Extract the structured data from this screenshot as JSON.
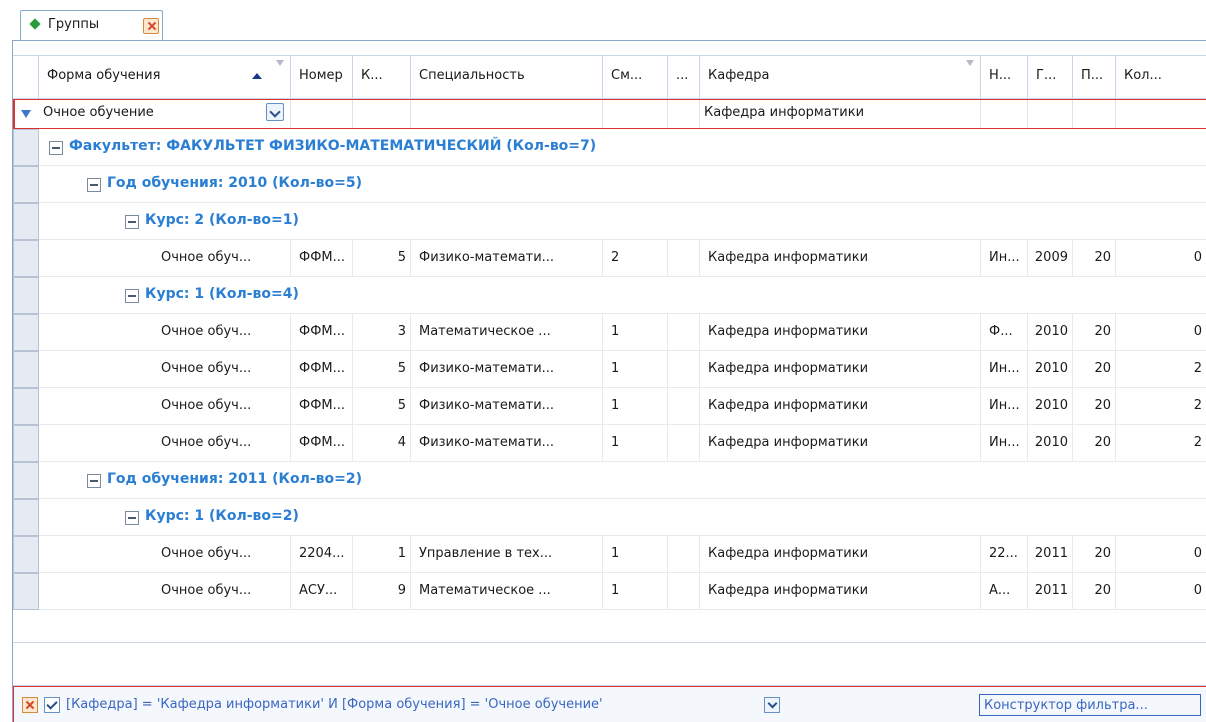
{
  "tab": {
    "title": "Группы"
  },
  "columns": [
    "Форма обучения",
    "Номер",
    "К...",
    "Специальность",
    "См...",
    "...",
    "Кафедра",
    "Н...",
    "Г...",
    "П...",
    "Кол..."
  ],
  "filter_row": {
    "form": "Очное обучение",
    "department": "Кафедра информатики"
  },
  "rows": [
    {
      "kind": "group",
      "level": 0,
      "label": "Факультет: ФАКУЛЬТЕТ ФИЗИКО-МАТЕМАТИЧЕСКИЙ (Кол-во=7)"
    },
    {
      "kind": "group",
      "level": 1,
      "label": "Год обучения: 2010 (Кол-во=5)"
    },
    {
      "kind": "group",
      "level": 2,
      "label": "Курс: 2 (Кол-во=1)"
    },
    {
      "kind": "data",
      "cells": [
        "Очное обуч...",
        "ФФМ...",
        "5",
        "Физико-математи...",
        "2",
        "",
        "Кафедра информатики",
        "Ин...",
        "2009",
        "20",
        "0"
      ]
    },
    {
      "kind": "group",
      "level": 2,
      "label": "Курс: 1 (Кол-во=4)"
    },
    {
      "kind": "data",
      "cells": [
        "Очное обуч...",
        "ФФМ...",
        "3",
        "Математическое ...",
        "1",
        "",
        "Кафедра информатики",
        "Ф...",
        "2010",
        "20",
        "0"
      ]
    },
    {
      "kind": "data",
      "cells": [
        "Очное обуч...",
        "ФФМ...",
        "5",
        "Физико-математи...",
        "1",
        "",
        "Кафедра информатики",
        "Ин...",
        "2010",
        "20",
        "2"
      ]
    },
    {
      "kind": "data",
      "cells": [
        "Очное обуч...",
        "ФФМ...",
        "5",
        "Физико-математи...",
        "1",
        "",
        "Кафедра информатики",
        "Ин...",
        "2010",
        "20",
        "2"
      ]
    },
    {
      "kind": "data",
      "cells": [
        "Очное обуч...",
        "ФФМ...",
        "4",
        "Физико-математи...",
        "1",
        "",
        "Кафедра информатики",
        "Ин...",
        "2010",
        "20",
        "2"
      ]
    },
    {
      "kind": "group",
      "level": 1,
      "label": "Год обучения: 2011 (Кол-во=2)"
    },
    {
      "kind": "group",
      "level": 2,
      "label": "Курс: 1 (Кол-во=2)"
    },
    {
      "kind": "data",
      "cells": [
        "Очное обуч...",
        "2204...",
        "1",
        "Управление в тех...",
        "1",
        "",
        "Кафедра информатики",
        "22...",
        "2011",
        "20",
        "0"
      ]
    },
    {
      "kind": "data",
      "cells": [
        "Очное обуч...",
        "АСУ...",
        "9",
        "Математическое ...",
        "1",
        "",
        "Кафедра информатики",
        "А...",
        "2011",
        "20",
        "0"
      ]
    }
  ],
  "filter_panel": {
    "expression": "[Кафедра] = 'Кафедра информатики' И [Форма обучения] = 'Очное обучение'",
    "builder_label": "Конструктор фильтра..."
  }
}
